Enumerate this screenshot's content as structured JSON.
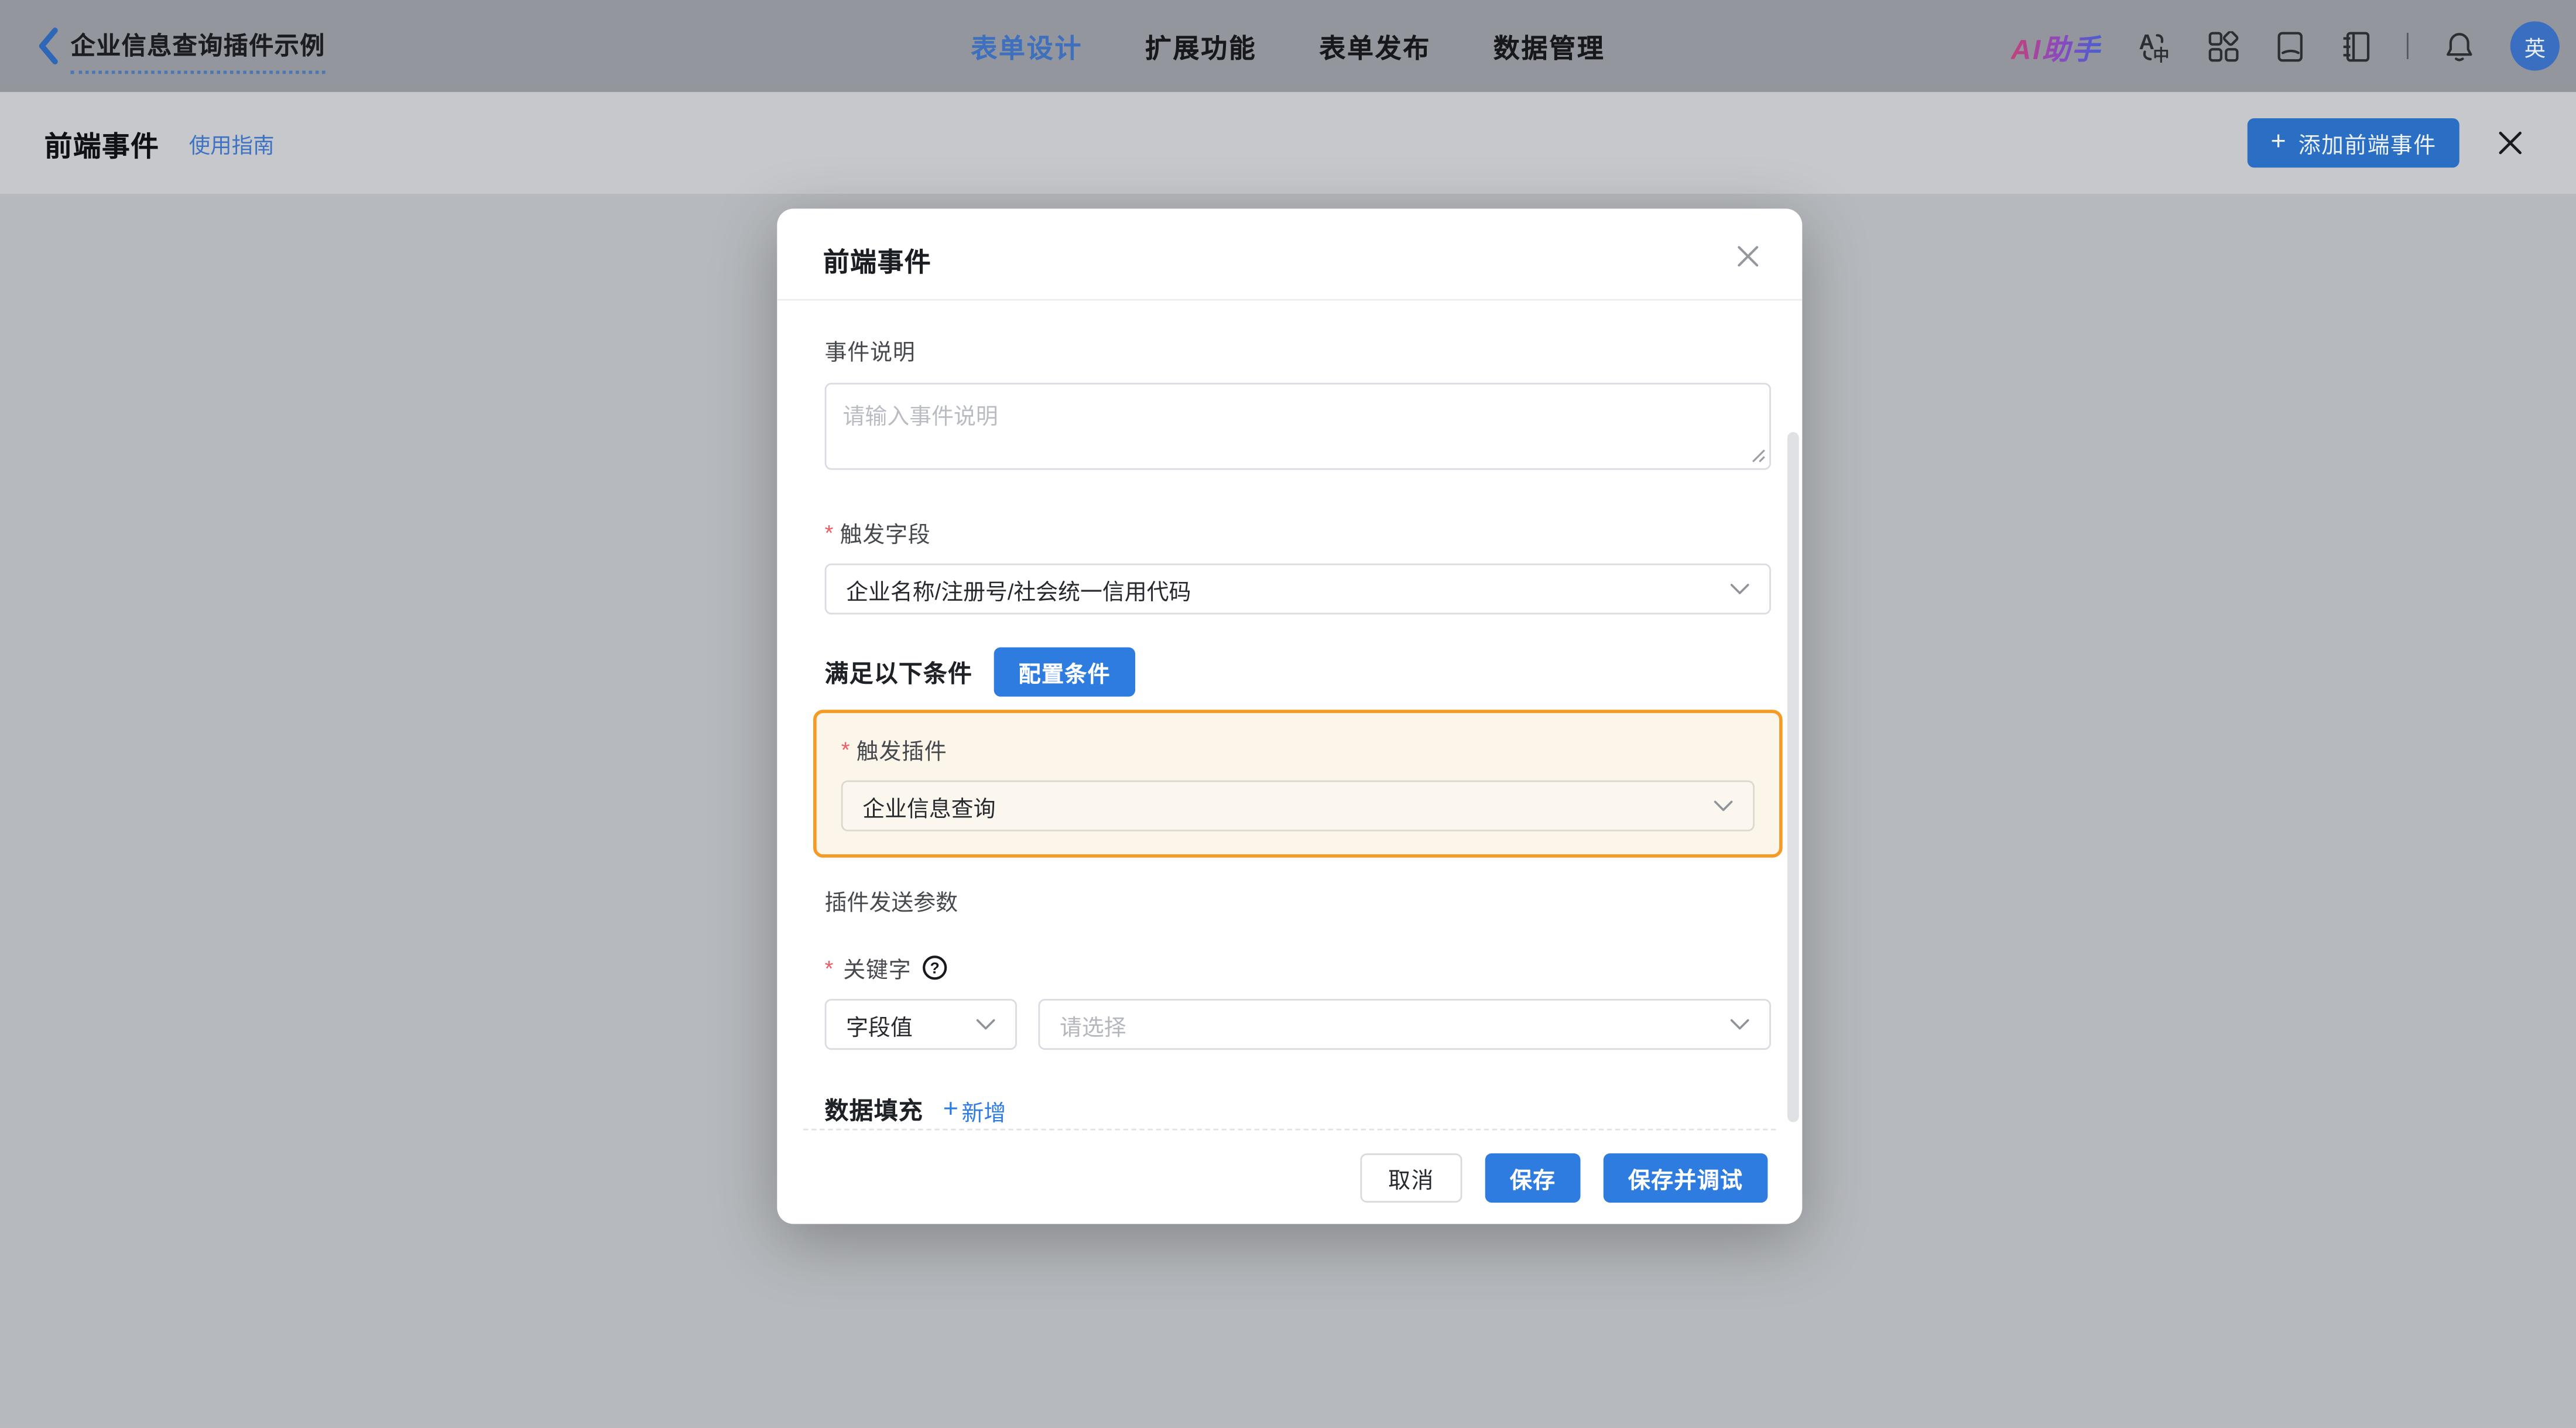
{
  "navbar": {
    "title": "企业信息查询插件示例",
    "tabs": [
      {
        "label": "表单设计",
        "active": true
      },
      {
        "label": "扩展功能",
        "active": false
      },
      {
        "label": "表单发布",
        "active": false
      },
      {
        "label": "数据管理",
        "active": false
      }
    ],
    "ai_assistant_label": "AI助手",
    "avatar_text": "英"
  },
  "panel_header": {
    "title": "前端事件",
    "guide_link": "使用指南",
    "plus": "+",
    "add_button_label": "添加前端事件"
  },
  "dialog": {
    "title": "前端事件",
    "required_mark": "*",
    "event_desc": {
      "label": "事件说明",
      "placeholder": "请输入事件说明"
    },
    "trigger_field": {
      "label": "触发字段",
      "value": "企业名称/注册号/社会统一信用代码"
    },
    "condition": {
      "text": "满足以下条件",
      "button_label": "配置条件"
    },
    "trigger_plugin": {
      "label": "触发插件",
      "value": "企业信息查询"
    },
    "plugin_params_label": "插件发送参数",
    "keyword": {
      "label": "关键字",
      "type_value": "字段值",
      "value_placeholder": "请选择"
    },
    "data_fill": {
      "label": "数据填充",
      "plus": "+",
      "add_label": "新增"
    },
    "footer": {
      "cancel_label": "取消",
      "save_label": "保存",
      "save_debug_label": "保存并调试"
    }
  },
  "colors": {
    "accent_blue": "#2e7ce0",
    "highlight_border_orange": "#f59b25",
    "highlight_bg_cream": "#fcf5e9",
    "required_red": "#ee5d66",
    "navbar_bg_dimmed": "#94969e",
    "panel_header_bg_dimmed": "#c6c8cb",
    "content_bg_dimmed": "#b6b9bd",
    "avatar_bg": "#3a6ec1"
  }
}
